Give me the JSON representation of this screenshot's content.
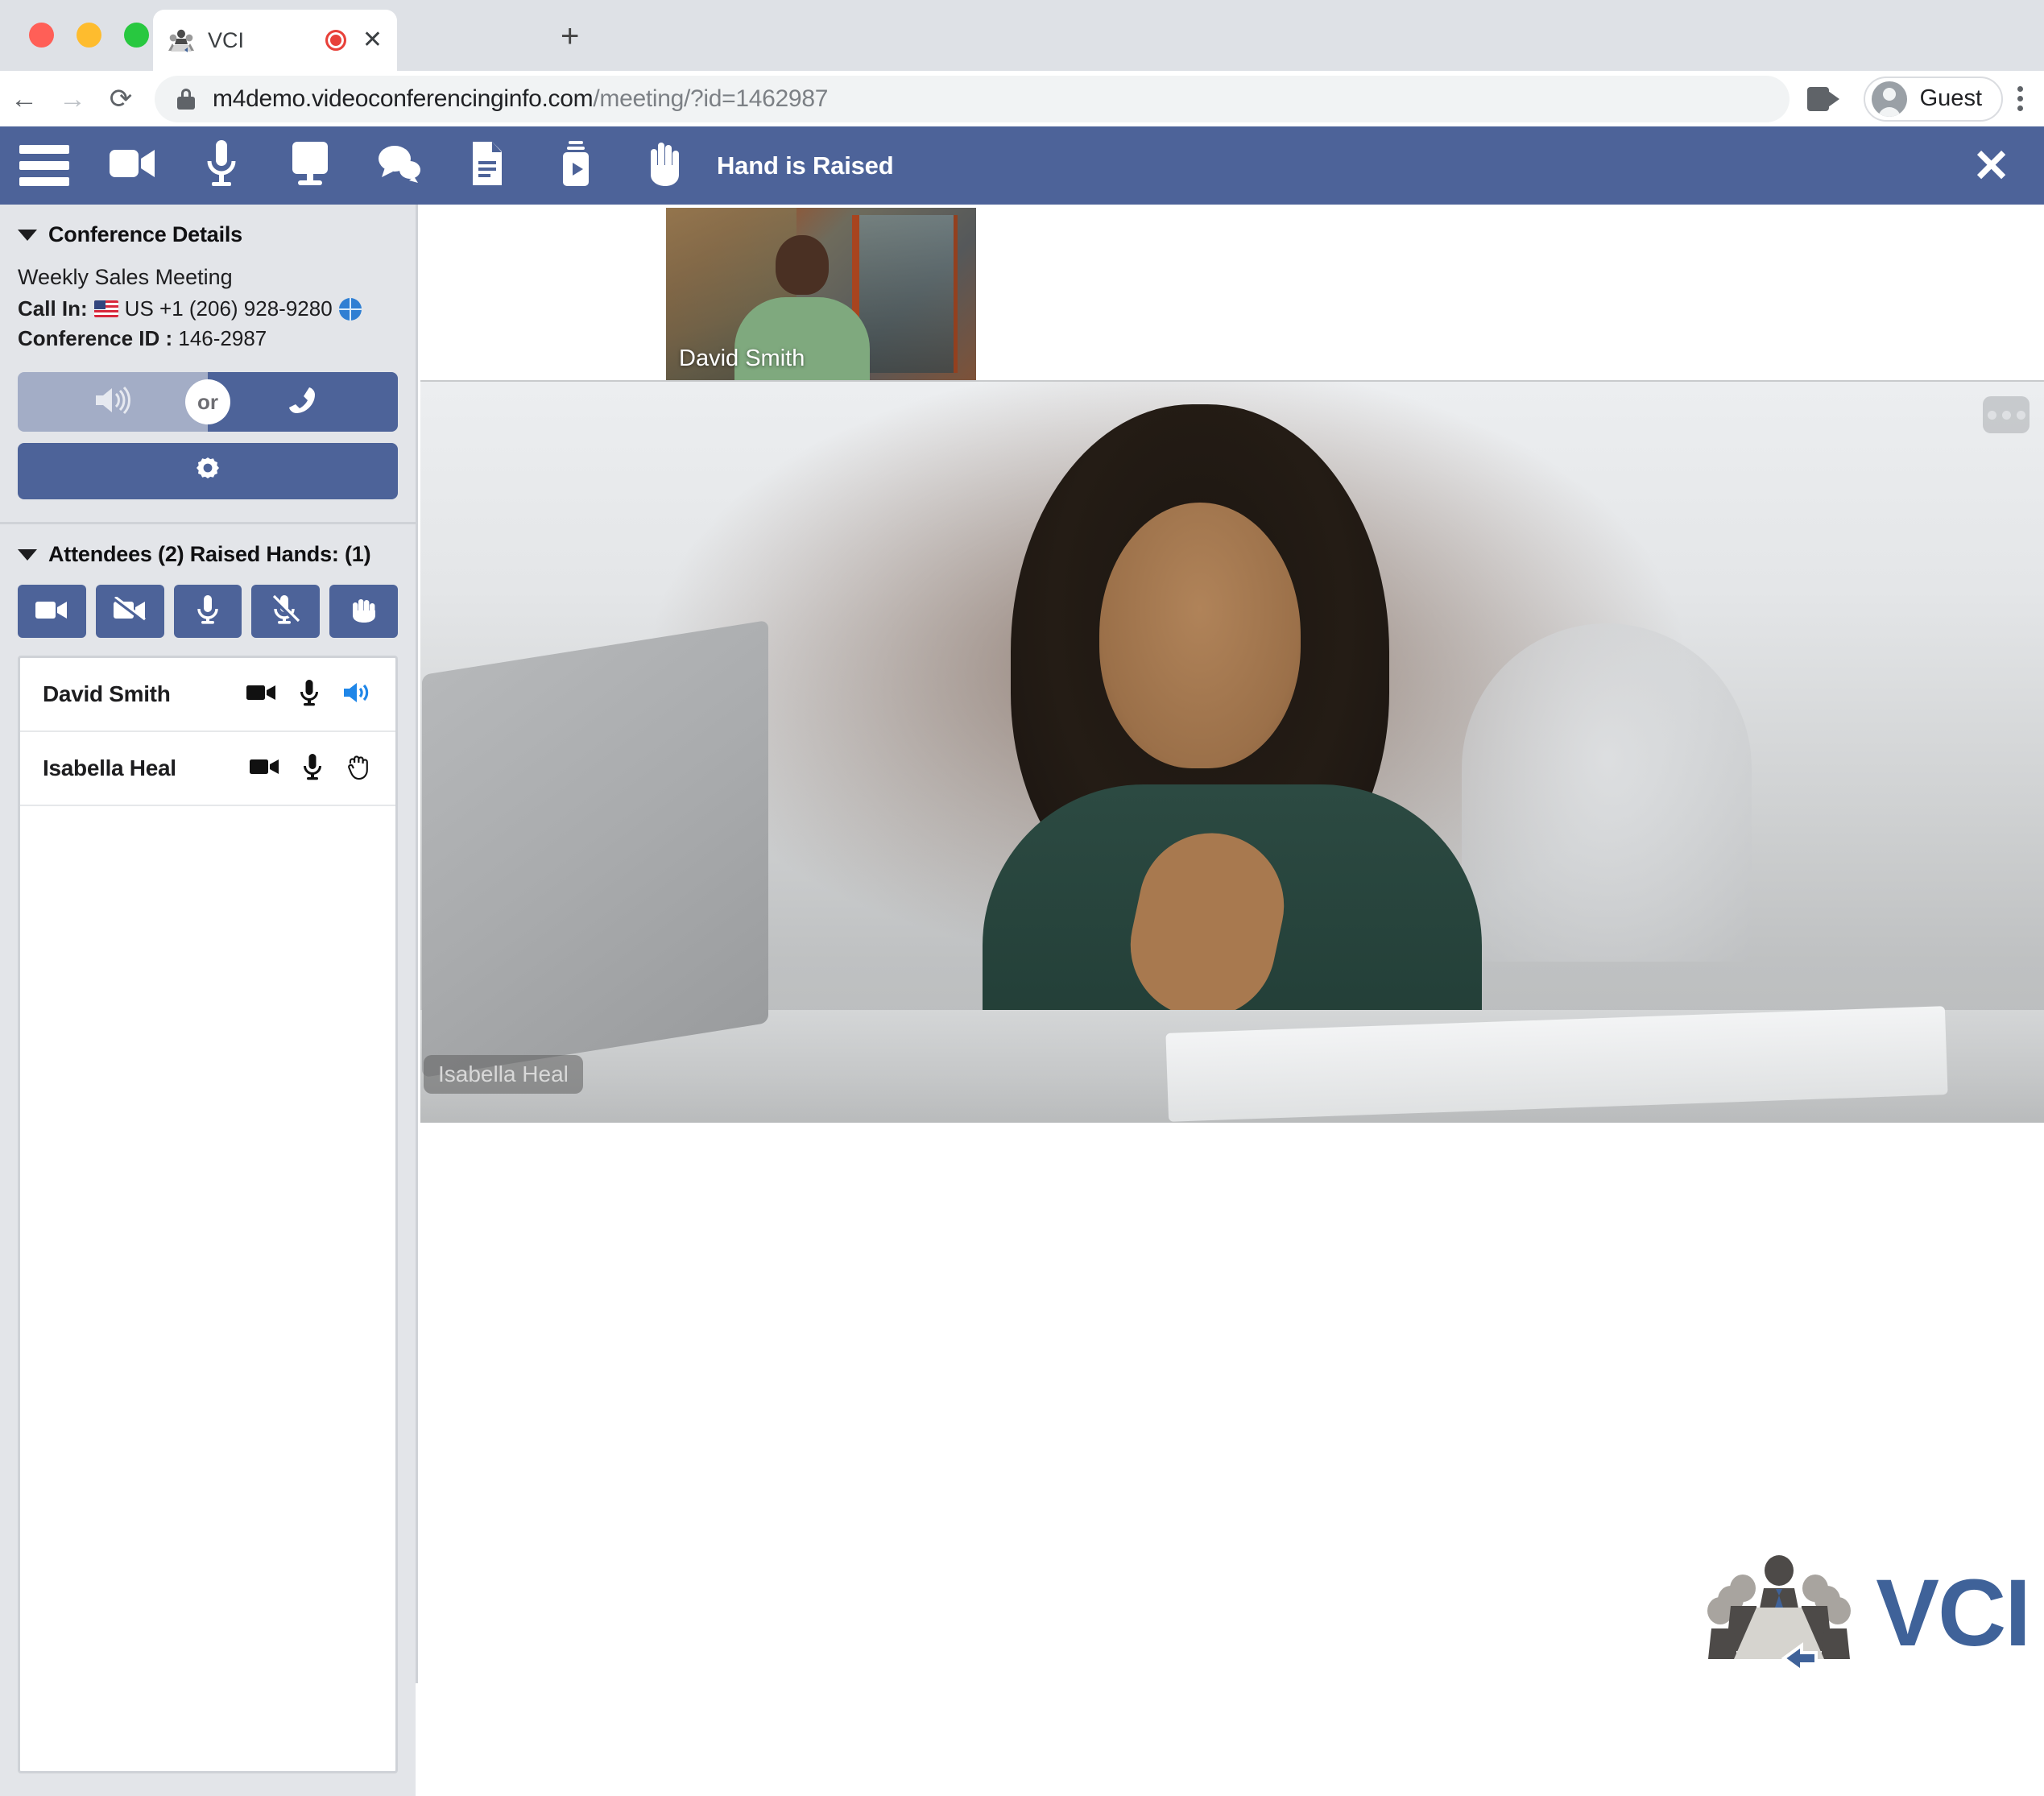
{
  "browser": {
    "tab": {
      "title": "VCI",
      "favicon_icon": "vci-conference-favicon",
      "recording_icon": "record-dot-icon",
      "close_icon": "close-icon"
    },
    "new_tab_icon": "plus-icon",
    "nav": {
      "back_icon": "back-arrow-icon",
      "forward_icon": "forward-arrow-icon",
      "reload_icon": "reload-icon"
    },
    "omnibox": {
      "lock_icon": "lock-icon",
      "url_domain": "m4demo.videoconferencinginfo.com",
      "url_path": "/meeting/?id=1462987",
      "full_url": "m4demo.videoconferencinginfo.com/meeting/?id=1462987"
    },
    "camera_indicator_icon": "camera-indicator-icon",
    "profile": {
      "name": "Guest",
      "avatar_icon": "avatar-icon"
    },
    "menu_icon": "kebab-menu-icon"
  },
  "appbar": {
    "menu_icon": "hamburger-menu-icon",
    "buttons": [
      {
        "name": "video-camera",
        "icon": "video-camera-icon"
      },
      {
        "name": "microphone",
        "icon": "microphone-icon"
      },
      {
        "name": "share-screen",
        "icon": "monitor-icon"
      },
      {
        "name": "chat",
        "icon": "chat-bubbles-icon"
      },
      {
        "name": "documents",
        "icon": "document-icon"
      },
      {
        "name": "recordings",
        "icon": "media-play-icon"
      },
      {
        "name": "raise-hand",
        "icon": "raised-hand-icon"
      }
    ],
    "status_label": "Hand is Raised",
    "close_label": "✕",
    "bg_color": "#4d6399"
  },
  "sidebar": {
    "conference": {
      "title": "Conference Details",
      "caret_icon": "caret-down-icon",
      "meeting_name": "Weekly Sales Meeting",
      "call_in_label": "Call In:",
      "flag_icon": "us-flag-icon",
      "phone_number": "US +1 (206) 928-9280",
      "globe_icon": "globe-icon",
      "conference_id_label": "Conference ID :",
      "conference_id": "146-2987",
      "audio": {
        "computer_audio_icon": "speaker-icon",
        "or_label": "or",
        "dial_in_icon": "phone-handset-icon"
      },
      "settings_icon": "gear-icon"
    },
    "attendees": {
      "title": "Attendees (2) Raised Hands: (1)",
      "caret_icon": "caret-down-icon",
      "controls": [
        {
          "name": "enable-all-cameras",
          "icon": "camera-on-icon"
        },
        {
          "name": "disable-all-cameras",
          "icon": "camera-off-icon"
        },
        {
          "name": "unmute-all",
          "icon": "mic-on-icon"
        },
        {
          "name": "mute-all",
          "icon": "mic-off-icon"
        },
        {
          "name": "lower-all-hands",
          "icon": "hand-icon"
        }
      ],
      "rows": [
        {
          "name": "David Smith",
          "icons": [
            "camera-icon",
            "microphone-icon",
            "speaker-active-icon"
          ]
        },
        {
          "name": "Isabella Heal",
          "icons": [
            "camera-icon",
            "microphone-icon",
            "raised-hand-outline-icon"
          ]
        }
      ]
    }
  },
  "stage": {
    "thumbnail": {
      "name": "David Smith"
    },
    "main": {
      "name": "Isabella Heal",
      "more_icon": "more-options-icon"
    }
  },
  "logo": {
    "text": "VCI",
    "mark_icon": "vci-conference-table-icon",
    "color": "#3f6299"
  }
}
